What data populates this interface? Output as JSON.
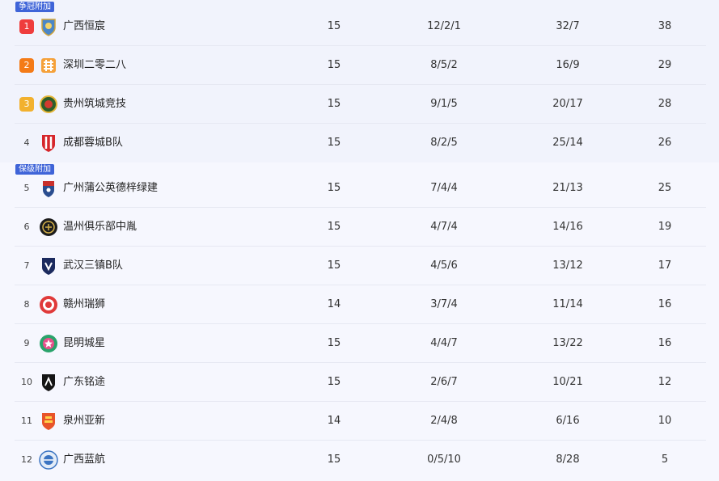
{
  "tags": {
    "top": "争冠附加",
    "bottom": "保级附加"
  },
  "rows": [
    {
      "rank": "1",
      "team": "广西恒宸",
      "played": "15",
      "wdl": "12/2/1",
      "gfga": "32/7",
      "pts": "38"
    },
    {
      "rank": "2",
      "team": "深圳二零二八",
      "played": "15",
      "wdl": "8/5/2",
      "gfga": "16/9",
      "pts": "29"
    },
    {
      "rank": "3",
      "team": "贵州筑城竞技",
      "played": "15",
      "wdl": "9/1/5",
      "gfga": "20/17",
      "pts": "28"
    },
    {
      "rank": "4",
      "team": "成都蓉城B队",
      "played": "15",
      "wdl": "8/2/5",
      "gfga": "25/14",
      "pts": "26"
    },
    {
      "rank": "5",
      "team": "广州蒲公英德梓绿建",
      "played": "15",
      "wdl": "7/4/4",
      "gfga": "21/13",
      "pts": "25"
    },
    {
      "rank": "6",
      "team": "温州俱乐部中胤",
      "played": "15",
      "wdl": "4/7/4",
      "gfga": "14/16",
      "pts": "19"
    },
    {
      "rank": "7",
      "team": "武汉三镇B队",
      "played": "15",
      "wdl": "4/5/6",
      "gfga": "13/12",
      "pts": "17"
    },
    {
      "rank": "8",
      "team": "赣州瑞狮",
      "played": "14",
      "wdl": "3/7/4",
      "gfga": "11/14",
      "pts": "16"
    },
    {
      "rank": "9",
      "team": "昆明城星",
      "played": "15",
      "wdl": "4/4/7",
      "gfga": "13/22",
      "pts": "16"
    },
    {
      "rank": "10",
      "team": "广东铭途",
      "played": "15",
      "wdl": "2/6/7",
      "gfga": "10/21",
      "pts": "12"
    },
    {
      "rank": "11",
      "team": "泉州亚新",
      "played": "14",
      "wdl": "2/4/8",
      "gfga": "6/16",
      "pts": "10"
    },
    {
      "rank": "12",
      "team": "广西蓝航",
      "played": "15",
      "wdl": "0/5/10",
      "gfga": "8/28",
      "pts": "5"
    }
  ],
  "colors": {
    "rank1": "#ef3d3d",
    "rank2": "#f47b17",
    "rank3": "#f2b12e",
    "tag": "#3f64d8",
    "group_top_bg": "#f1f3fc",
    "group_bottom_bg": "#f6f7fe"
  },
  "icons": {
    "r1": "guangxi-hengchen-crest-icon",
    "r2": "shenzhen-2028-crest-icon",
    "r3": "guizhou-zhucheng-crest-icon",
    "r4": "chengdu-rongcheng-b-crest-icon",
    "r5": "guangzhou-dandelion-crest-icon",
    "r6": "wenzhou-club-crest-icon",
    "r7": "wuhan-three-towns-b-crest-icon",
    "r8": "ganzhou-ruishi-crest-icon",
    "r9": "kunming-city-star-crest-icon",
    "r10": "guangdong-mingtu-crest-icon",
    "r11": "quanzhou-yaxin-crest-icon",
    "r12": "guangxi-lanhang-crest-icon"
  }
}
